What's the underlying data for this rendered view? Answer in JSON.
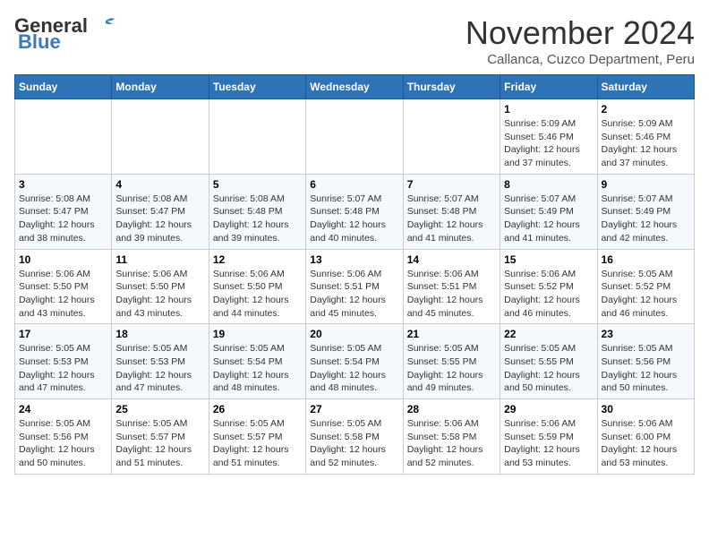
{
  "header": {
    "logo_general": "General",
    "logo_blue": "Blue",
    "title": "November 2024",
    "subtitle": "Callanca, Cuzco Department, Peru"
  },
  "weekdays": [
    "Sunday",
    "Monday",
    "Tuesday",
    "Wednesday",
    "Thursday",
    "Friday",
    "Saturday"
  ],
  "weeks": [
    [
      {
        "day": "",
        "info": ""
      },
      {
        "day": "",
        "info": ""
      },
      {
        "day": "",
        "info": ""
      },
      {
        "day": "",
        "info": ""
      },
      {
        "day": "",
        "info": ""
      },
      {
        "day": "1",
        "info": "Sunrise: 5:09 AM\nSunset: 5:46 PM\nDaylight: 12 hours\nand 37 minutes."
      },
      {
        "day": "2",
        "info": "Sunrise: 5:09 AM\nSunset: 5:46 PM\nDaylight: 12 hours\nand 37 minutes."
      }
    ],
    [
      {
        "day": "3",
        "info": "Sunrise: 5:08 AM\nSunset: 5:47 PM\nDaylight: 12 hours\nand 38 minutes."
      },
      {
        "day": "4",
        "info": "Sunrise: 5:08 AM\nSunset: 5:47 PM\nDaylight: 12 hours\nand 39 minutes."
      },
      {
        "day": "5",
        "info": "Sunrise: 5:08 AM\nSunset: 5:48 PM\nDaylight: 12 hours\nand 39 minutes."
      },
      {
        "day": "6",
        "info": "Sunrise: 5:07 AM\nSunset: 5:48 PM\nDaylight: 12 hours\nand 40 minutes."
      },
      {
        "day": "7",
        "info": "Sunrise: 5:07 AM\nSunset: 5:48 PM\nDaylight: 12 hours\nand 41 minutes."
      },
      {
        "day": "8",
        "info": "Sunrise: 5:07 AM\nSunset: 5:49 PM\nDaylight: 12 hours\nand 41 minutes."
      },
      {
        "day": "9",
        "info": "Sunrise: 5:07 AM\nSunset: 5:49 PM\nDaylight: 12 hours\nand 42 minutes."
      }
    ],
    [
      {
        "day": "10",
        "info": "Sunrise: 5:06 AM\nSunset: 5:50 PM\nDaylight: 12 hours\nand 43 minutes."
      },
      {
        "day": "11",
        "info": "Sunrise: 5:06 AM\nSunset: 5:50 PM\nDaylight: 12 hours\nand 43 minutes."
      },
      {
        "day": "12",
        "info": "Sunrise: 5:06 AM\nSunset: 5:50 PM\nDaylight: 12 hours\nand 44 minutes."
      },
      {
        "day": "13",
        "info": "Sunrise: 5:06 AM\nSunset: 5:51 PM\nDaylight: 12 hours\nand 45 minutes."
      },
      {
        "day": "14",
        "info": "Sunrise: 5:06 AM\nSunset: 5:51 PM\nDaylight: 12 hours\nand 45 minutes."
      },
      {
        "day": "15",
        "info": "Sunrise: 5:06 AM\nSunset: 5:52 PM\nDaylight: 12 hours\nand 46 minutes."
      },
      {
        "day": "16",
        "info": "Sunrise: 5:05 AM\nSunset: 5:52 PM\nDaylight: 12 hours\nand 46 minutes."
      }
    ],
    [
      {
        "day": "17",
        "info": "Sunrise: 5:05 AM\nSunset: 5:53 PM\nDaylight: 12 hours\nand 47 minutes."
      },
      {
        "day": "18",
        "info": "Sunrise: 5:05 AM\nSunset: 5:53 PM\nDaylight: 12 hours\nand 47 minutes."
      },
      {
        "day": "19",
        "info": "Sunrise: 5:05 AM\nSunset: 5:54 PM\nDaylight: 12 hours\nand 48 minutes."
      },
      {
        "day": "20",
        "info": "Sunrise: 5:05 AM\nSunset: 5:54 PM\nDaylight: 12 hours\nand 48 minutes."
      },
      {
        "day": "21",
        "info": "Sunrise: 5:05 AM\nSunset: 5:55 PM\nDaylight: 12 hours\nand 49 minutes."
      },
      {
        "day": "22",
        "info": "Sunrise: 5:05 AM\nSunset: 5:55 PM\nDaylight: 12 hours\nand 50 minutes."
      },
      {
        "day": "23",
        "info": "Sunrise: 5:05 AM\nSunset: 5:56 PM\nDaylight: 12 hours\nand 50 minutes."
      }
    ],
    [
      {
        "day": "24",
        "info": "Sunrise: 5:05 AM\nSunset: 5:56 PM\nDaylight: 12 hours\nand 50 minutes."
      },
      {
        "day": "25",
        "info": "Sunrise: 5:05 AM\nSunset: 5:57 PM\nDaylight: 12 hours\nand 51 minutes."
      },
      {
        "day": "26",
        "info": "Sunrise: 5:05 AM\nSunset: 5:57 PM\nDaylight: 12 hours\nand 51 minutes."
      },
      {
        "day": "27",
        "info": "Sunrise: 5:05 AM\nSunset: 5:58 PM\nDaylight: 12 hours\nand 52 minutes."
      },
      {
        "day": "28",
        "info": "Sunrise: 5:06 AM\nSunset: 5:58 PM\nDaylight: 12 hours\nand 52 minutes."
      },
      {
        "day": "29",
        "info": "Sunrise: 5:06 AM\nSunset: 5:59 PM\nDaylight: 12 hours\nand 53 minutes."
      },
      {
        "day": "30",
        "info": "Sunrise: 5:06 AM\nSunset: 6:00 PM\nDaylight: 12 hours\nand 53 minutes."
      }
    ]
  ]
}
